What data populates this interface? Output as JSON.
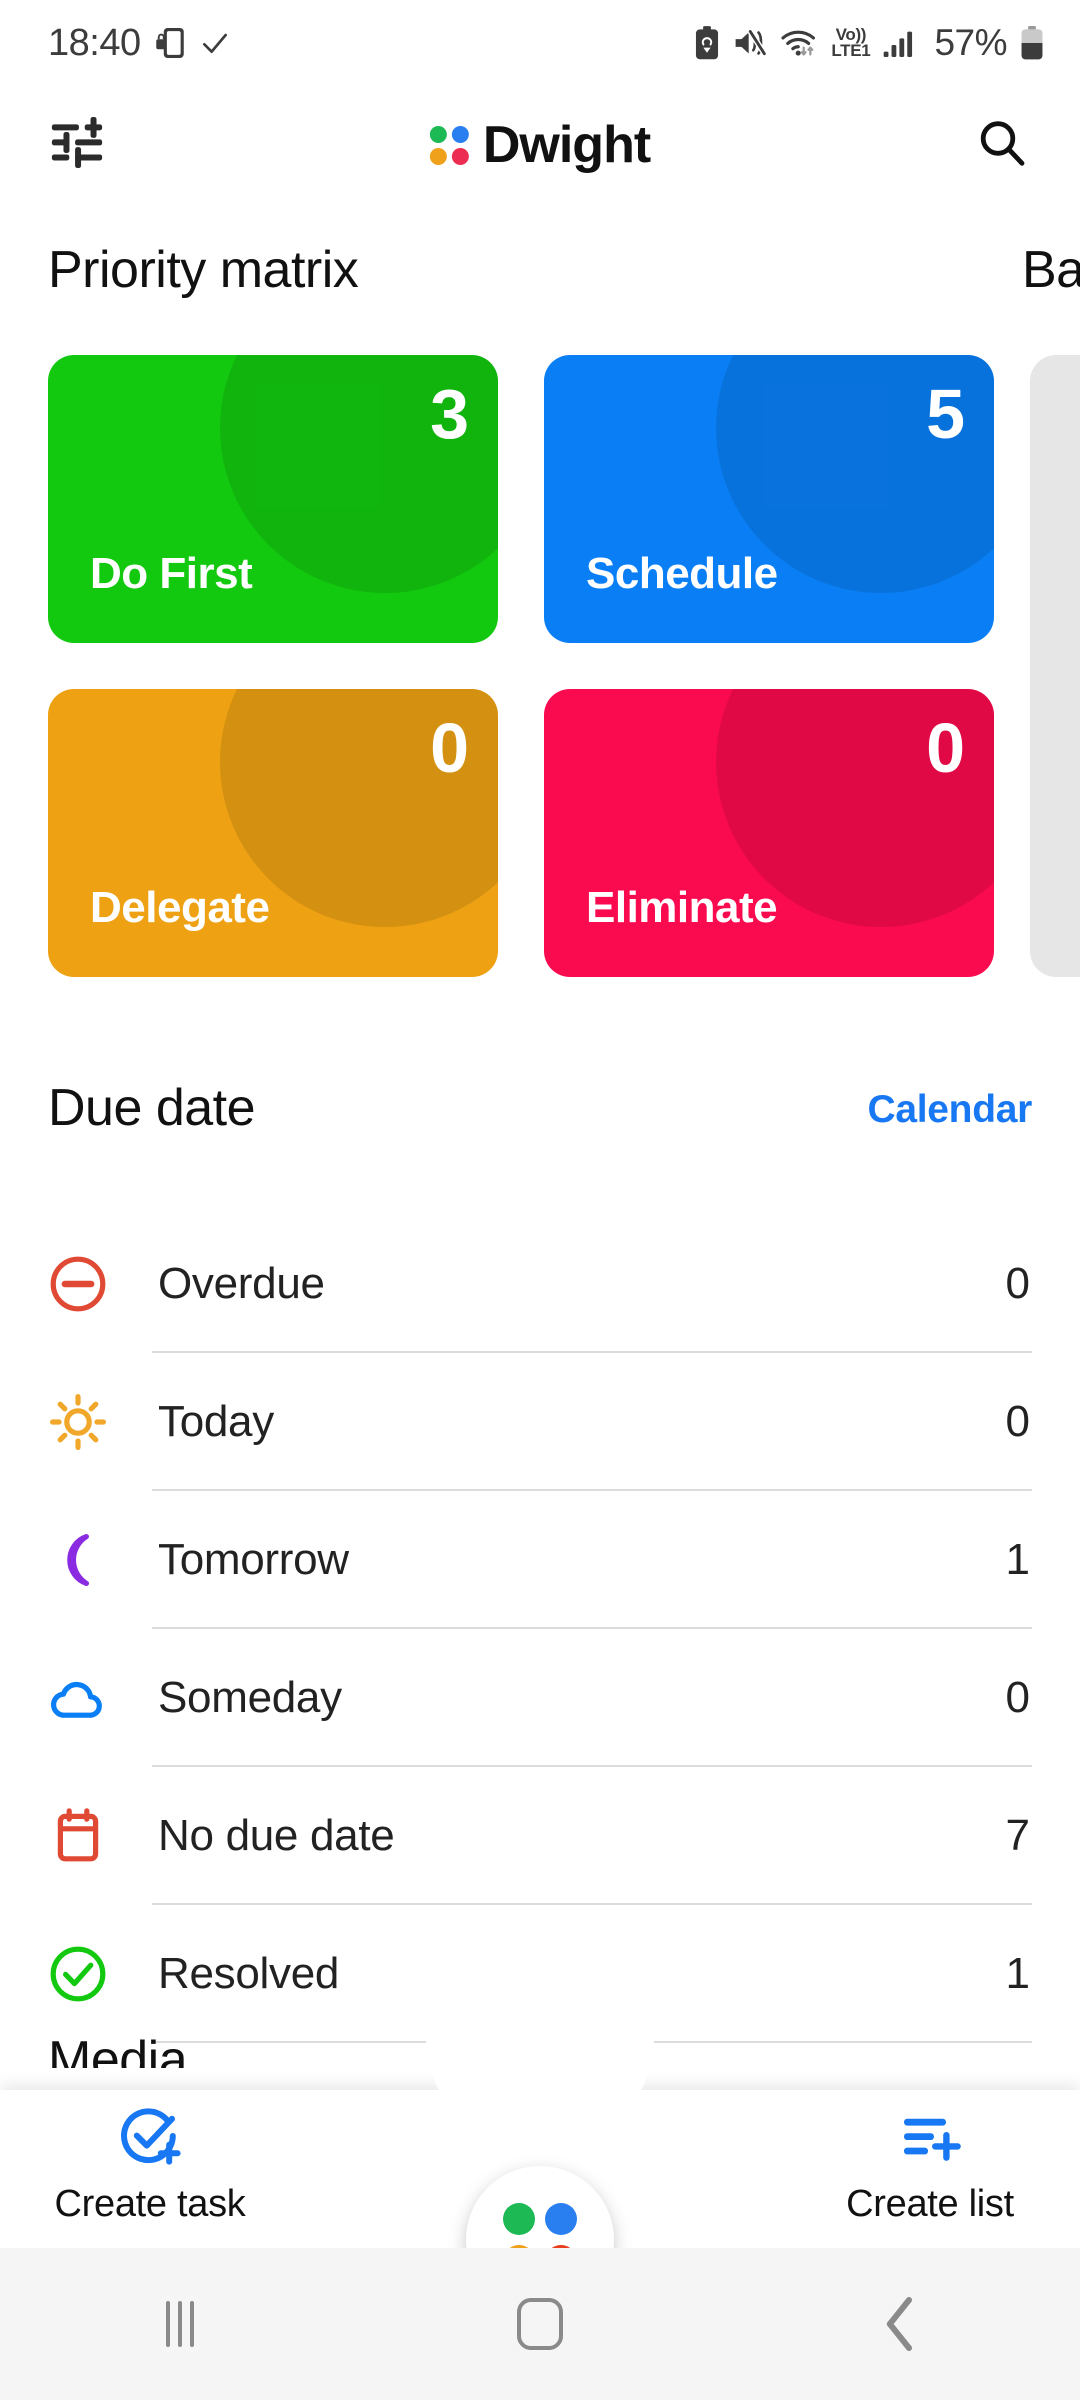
{
  "statusbar": {
    "time": "18:40",
    "battery_percent": "57%",
    "icons": [
      "screen-lock-icon",
      "check-icon",
      "battery-saver-icon",
      "mute-icon",
      "wifi-icon",
      "volte-icon",
      "signal-icon",
      "battery-icon"
    ],
    "volte_top": "Vo))",
    "volte_bottom": "LTE1"
  },
  "appbar": {
    "filter_icon": "tune-icon",
    "title": "Dwight",
    "search_icon": "search-icon",
    "logo_colors": [
      "#1db954",
      "#2a7ff0",
      "#f0a11b",
      "#ed2c53"
    ]
  },
  "matrix": {
    "title": "Priority matrix",
    "next_title": "Ba",
    "cards": [
      {
        "label": "Do First",
        "count": "3",
        "color": "#12c90f"
      },
      {
        "label": "Schedule",
        "count": "5",
        "color": "#0a7ff5"
      },
      {
        "label": "Delegate",
        "count": "0",
        "color": "#eda113"
      },
      {
        "label": "Eliminate",
        "count": "0",
        "color": "#fa0b4f"
      }
    ]
  },
  "due_date": {
    "title": "Due date",
    "calendar_link": "Calendar",
    "link_color": "#1877f2",
    "rows": [
      {
        "label": "Overdue",
        "count": "0",
        "icon": "minus-circle-icon",
        "color": "#e04a34"
      },
      {
        "label": "Today",
        "count": "0",
        "icon": "sun-icon",
        "color": "#f0a72a"
      },
      {
        "label": "Tomorrow",
        "count": "1",
        "icon": "moon-icon",
        "color": "#8a2be2"
      },
      {
        "label": "Someday",
        "count": "0",
        "icon": "cloud-icon",
        "color": "#0a7ff5"
      },
      {
        "label": "No due date",
        "count": "7",
        "icon": "calendar-icon",
        "color": "#e04a34"
      },
      {
        "label": "Resolved",
        "count": "1",
        "icon": "check-circle-icon",
        "color": "#12c90f"
      }
    ]
  },
  "cut_off_section_title": "Media",
  "bottombar": {
    "create_task": {
      "label": "Create task",
      "icon": "check-circle-plus-icon"
    },
    "create_list": {
      "label": "Create list",
      "icon": "list-plus-icon"
    },
    "fab": {
      "icon": "dwight-logo-icon",
      "colors": [
        "#1db954",
        "#2a7ff0",
        "#f0a11b",
        "#e8401f"
      ]
    }
  },
  "navbar": {
    "recents": "recents-icon",
    "home": "home-icon",
    "back": "back-icon"
  }
}
